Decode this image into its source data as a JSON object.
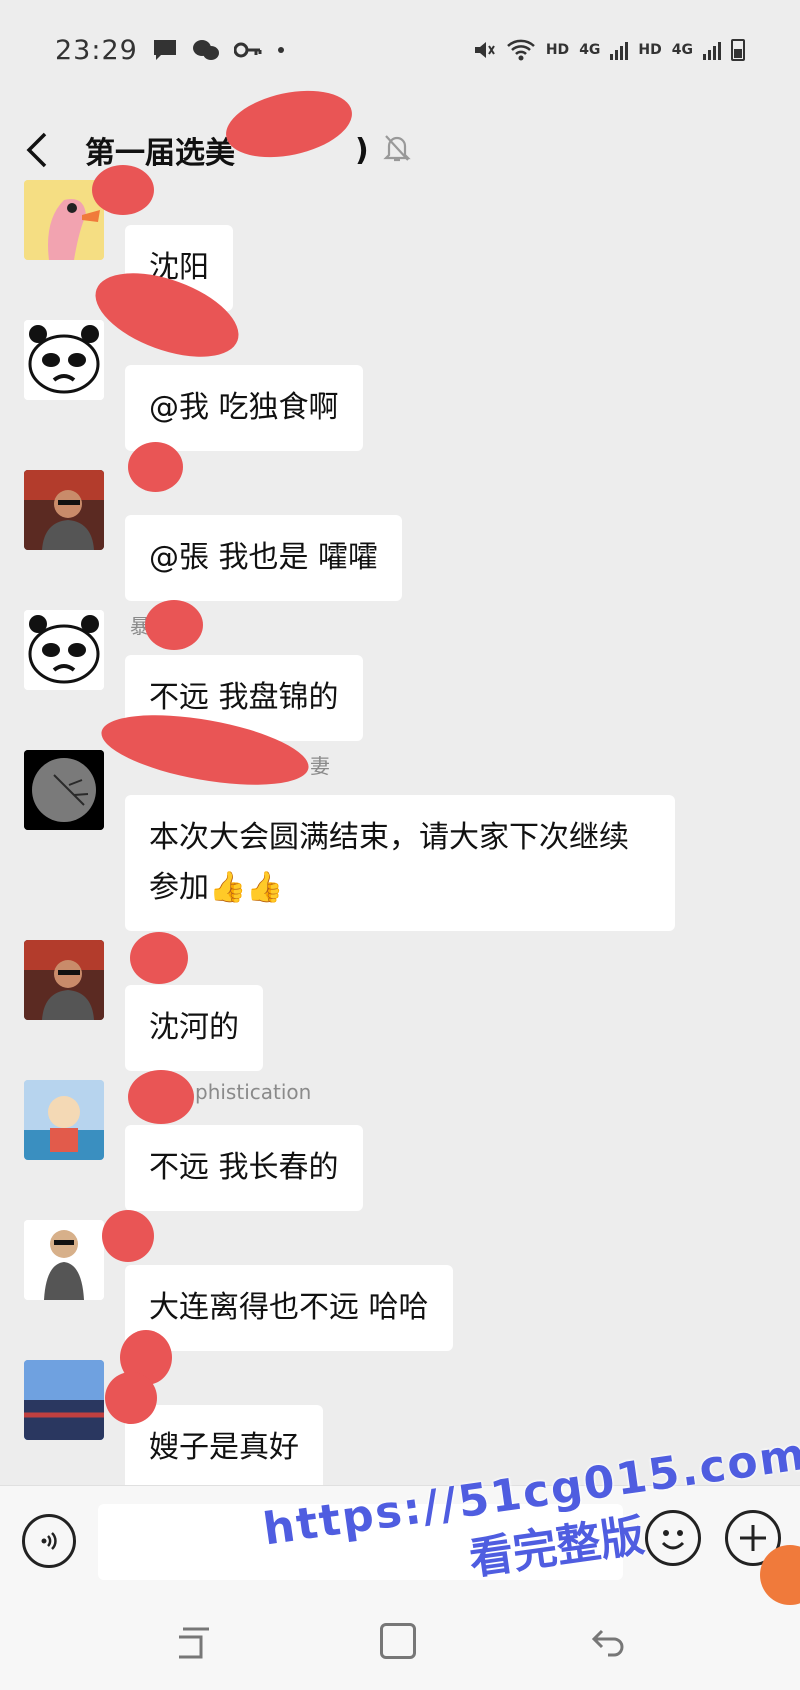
{
  "status_bar": {
    "time": "23:29",
    "network_label_1": "HD",
    "network_gen_1": "4G",
    "network_label_2": "HD",
    "network_gen_2": "4G"
  },
  "header": {
    "title": "第一届选美",
    "title_suffix": ")"
  },
  "messages": [
    {
      "sender": "",
      "text": "沈阳"
    },
    {
      "sender": "",
      "text": "@我  吃独食啊"
    },
    {
      "sender": "",
      "text": "@張  我也是 嚯嚯"
    },
    {
      "sender": "暴   猫",
      "text": "不远 我盘锦的"
    },
    {
      "sender": "妻",
      "text": "本次大会圆满结束，请大家下次继续参加👍👍"
    },
    {
      "sender": "",
      "text": "沈河的"
    },
    {
      "sender": "phistication",
      "text": "不远 我长春的"
    },
    {
      "sender": "",
      "text": "大连离得也不远 哈哈"
    },
    {
      "sender": "",
      "text": "嫂子是真好"
    }
  ],
  "input": {
    "value": "",
    "placeholder": ""
  },
  "watermark": {
    "url": "https://51cg015.com",
    "sub": "看完整版"
  },
  "colors": {
    "background": "#ededed",
    "bubble": "#ffffff",
    "redaction": "#e95555",
    "watermark": "#4f5de0"
  }
}
